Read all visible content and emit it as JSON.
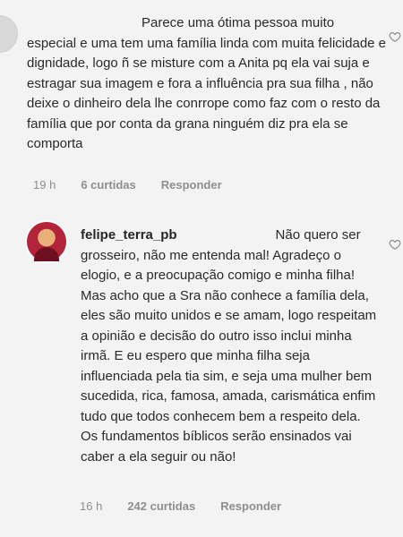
{
  "comments": [
    {
      "time": "19 h",
      "likes": "6 curtidas",
      "reply": "Responder",
      "text": "Parece uma ótima pessoa muito especial e uma tem uma família linda com muita felicidade e dignidade, logo ñ se misture com a Anita pq ela vai suja e estragar sua imagem e fora a influência pra sua filha , não deixe o dinheiro dela lhe conrrope como faz com o resto da família que por conta da grana ninguém diz pra ela se comporta"
    },
    {
      "username": "felipe_terra_pb",
      "time": "16 h",
      "likes": "242 curtidas",
      "reply": "Responder",
      "text": "Não quero ser grosseiro, não me entenda mal! Agradeço o elogio, e a preocupação comigo e minha filha! Mas acho que a Sra não conhece a família dela, eles são muito unidos e se amam, logo respeitam a opinião e decisão do outro isso inclui minha irmã. E eu espero que minha filha seja influenciada pela tia sim, e seja uma mulher bem sucedida, rica, famosa, amada, carismática enfim tudo que todos conhecem bem a respeito dela. Os fundamentos bíblicos serão ensinados vai caber a ela seguir ou não!"
    }
  ],
  "icons": {
    "heart": "heart-outline-icon"
  }
}
